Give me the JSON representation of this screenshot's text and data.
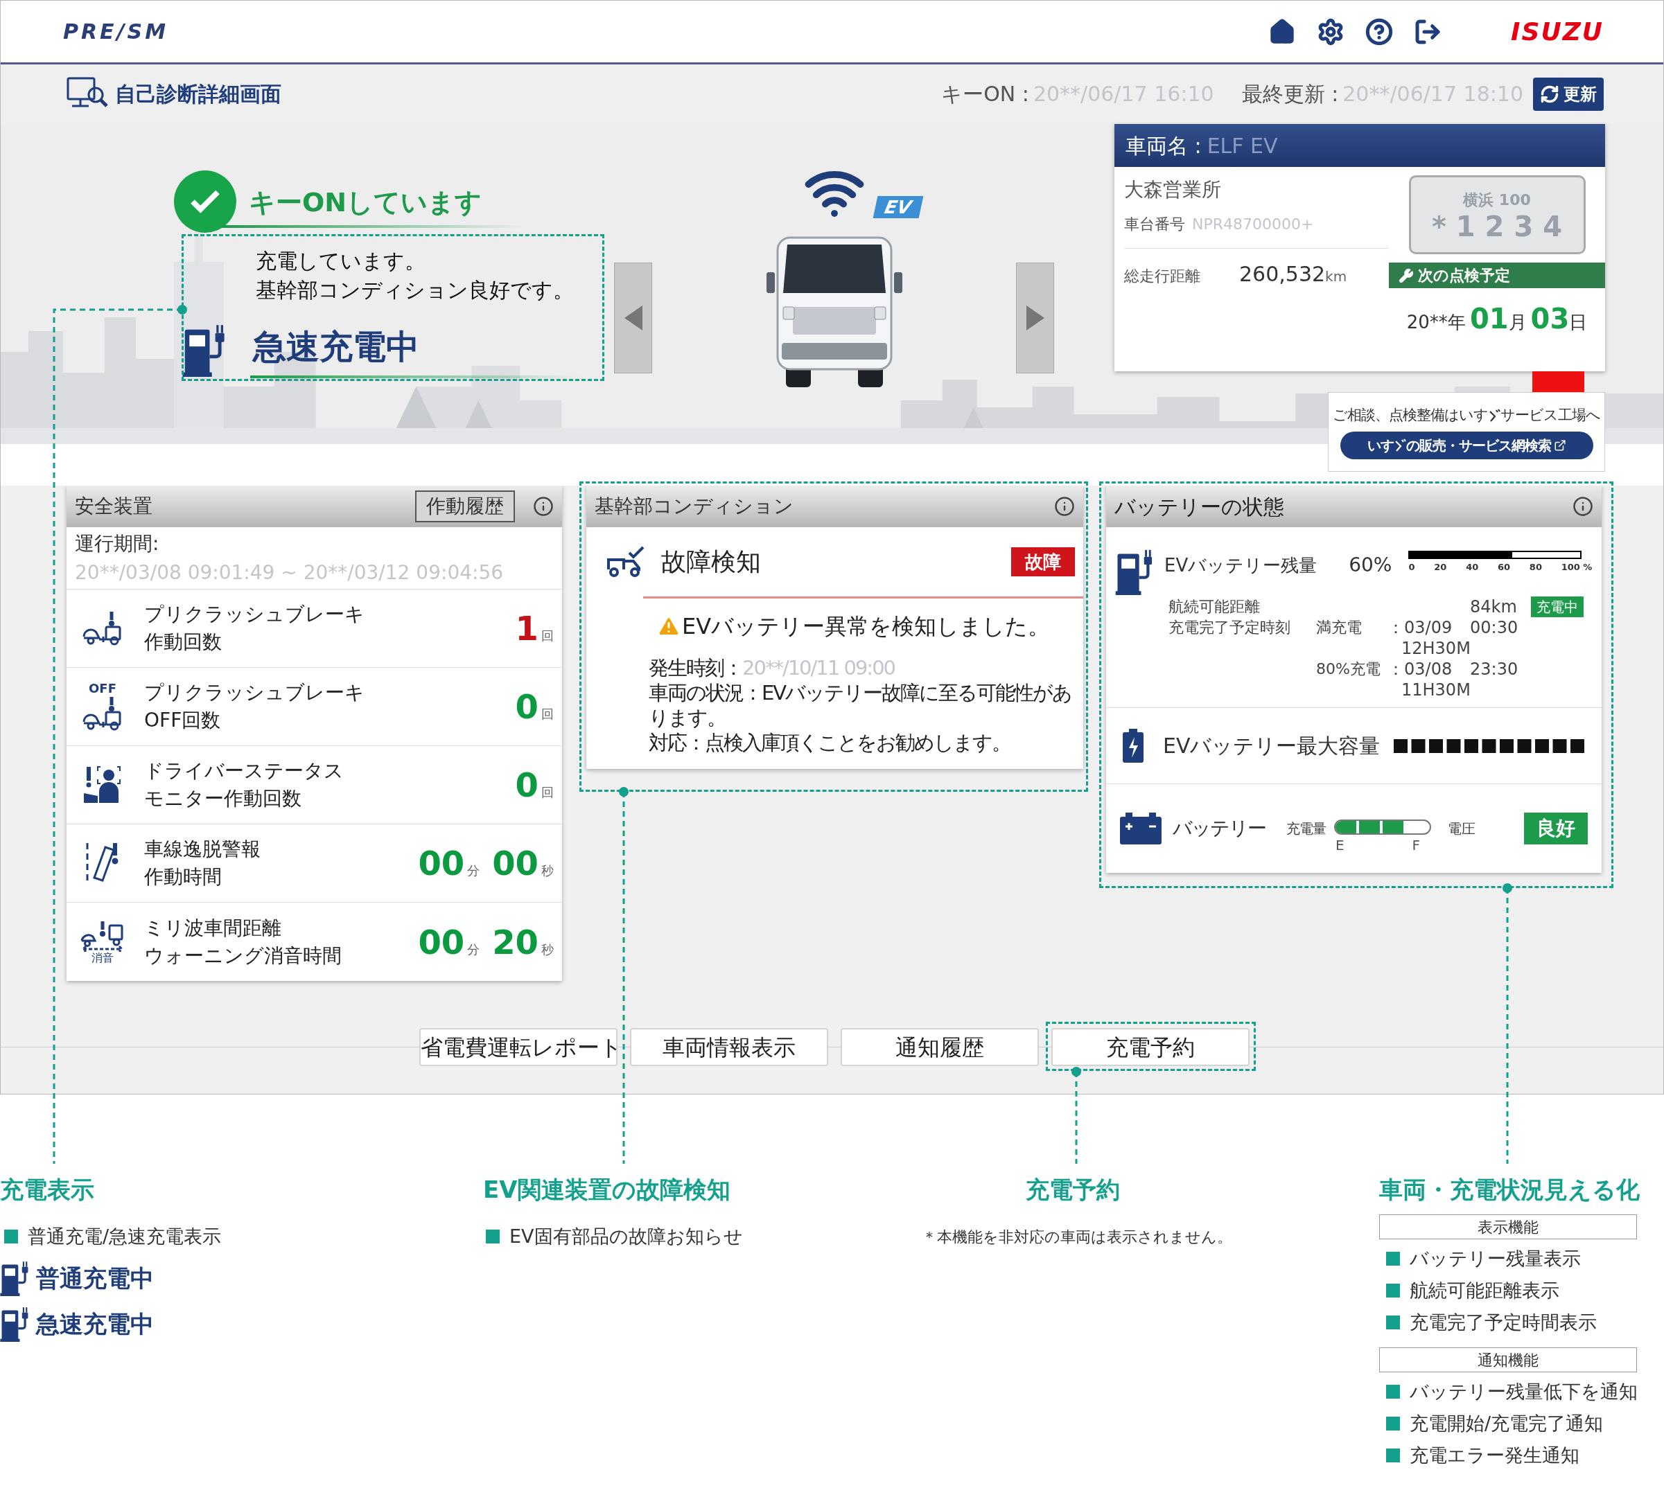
{
  "header": {
    "logo": "PRE/SM",
    "brand": "ISUZU"
  },
  "subheader": {
    "title": "自己診断詳細画面",
    "key_on_label": "キーON :",
    "key_on_time": "20**/06/17 16:10",
    "updated_label": "最終更新 :",
    "updated_time": "20**/06/17 18:10",
    "refresh_button": "更新"
  },
  "status": {
    "title": "キーONしています",
    "messages": [
      "充電しています。",
      "基幹部コンディション良好です。"
    ],
    "charging": "急速充電中",
    "ev_badge": "EV"
  },
  "vehicle": {
    "name_label": "車両名 :",
    "name": "ELF EV",
    "office": "大森営業所",
    "chassis_label": "車台番号",
    "chassis": "NPR48700000+",
    "mileage_label": "総走行距離",
    "mileage": "260,532",
    "mileage_unit": "km",
    "plate_top": "横浜 100",
    "plate_bottom": "* 1 2 3 4",
    "next_label": "次の点検予定",
    "year": "20**",
    "year_unit": "年",
    "month": "01",
    "month_unit": "月",
    "day": "03",
    "day_unit": "日"
  },
  "dealer": {
    "text_before": "ご相談、点検整備はいす",
    "text_after": "サービス工場へ",
    "button_before": "いす",
    "button_after": "の販売・サービス網検索"
  },
  "safety": {
    "title": "安全装置",
    "history_button": "作動履歴",
    "period_label": "運行期間:",
    "period": "20**/03/08 09:01:49 ~ 20**/03/12 09:04:56",
    "rows": [
      {
        "kind": "count",
        "line1": "プリクラッシュブレーキ",
        "line2": "作動回数",
        "value": "1",
        "unit": "回",
        "alert": true
      },
      {
        "kind": "count",
        "icon_label": "OFF",
        "line1": "プリクラッシュブレーキ",
        "line2": "OFF回数",
        "value": "0",
        "unit": "回",
        "alert": false
      },
      {
        "kind": "count",
        "line1": "ドライバーステータス",
        "line2": "モニター作動回数",
        "value": "0",
        "unit": "回",
        "alert": false
      },
      {
        "kind": "time",
        "line1": "車線逸脱警報",
        "line2": "作動時間",
        "minutes": "00",
        "minutes_unit": "分",
        "seconds": "00",
        "seconds_unit": "秒",
        "alert": false
      },
      {
        "kind": "time",
        "icon_label": "消音",
        "line1": "ミリ波車間距離",
        "line2": "ウォーニング消音時間",
        "minutes": "00",
        "minutes_unit": "分",
        "seconds": "20",
        "seconds_unit": "秒",
        "alert": false
      }
    ]
  },
  "condition": {
    "title": "基幹部コンディション",
    "item": "故障検知",
    "badge": "故障",
    "alert": "EVバッテリー異常を検知しました。",
    "occurred_label": "発生時刻：",
    "occurred": "20**/10/11 09:00",
    "status_text": "車両の状況：EVバッテリー故障に至る可能性があります。",
    "action_text": "対応：点検入庫頂くことをお勧めします。"
  },
  "battery": {
    "title": "バッテリーの状態",
    "ev_label": "EVバッテリー残量",
    "percent": "60%",
    "level": 0.6,
    "ticks": [
      "0",
      "20",
      "40",
      "60",
      "80",
      "100 %"
    ],
    "range_label": "航続可能距離",
    "range": "84km",
    "charging_badge": "充電中",
    "eta_label": "充電完了予定時刻",
    "eta": [
      {
        "label": "満充電",
        "date": "：03/09",
        "time": "00:30",
        "duration": "12H30M"
      },
      {
        "label": "80%充電",
        "date": "：03/08",
        "time": "23:30",
        "duration": "11H30M"
      }
    ],
    "max_label": "EVバッテリー最大容量",
    "aux_label": "バッテリー",
    "charge_label": "充電量",
    "charge": {
      "level": 0.75
    },
    "empty_label": "E",
    "full_label": "F",
    "voltage_label": "電圧",
    "voltage_status": "良好"
  },
  "bottom_buttons": [
    "省電費運転レポート",
    "車両情報表示",
    "通知履歴",
    "充電予約"
  ],
  "annotations": [
    {
      "title": "充電表示",
      "bullets": [
        "普通充電/急速充電表示"
      ],
      "examples": [
        "普通充電中",
        "急速充電中"
      ]
    },
    {
      "title": "EV関連装置の故障検知",
      "bullets": [
        "EV固有部品の故障お知らせ"
      ]
    },
    {
      "title": "充電予約",
      "note": "＊本機能を非対応の車両は表示されません。"
    },
    {
      "title": "車両・充電状況見える化",
      "groups": [
        {
          "heading": "表示機能",
          "bullets": [
            "バッテリー残量表示",
            "航続可能距離表示",
            "充電完了予定時間表示"
          ]
        },
        {
          "heading": "通知機能",
          "bullets": [
            "バッテリー残量低下を通知",
            "充電開始/充電完了通知",
            "充電エラー発生通知"
          ]
        }
      ]
    }
  ]
}
